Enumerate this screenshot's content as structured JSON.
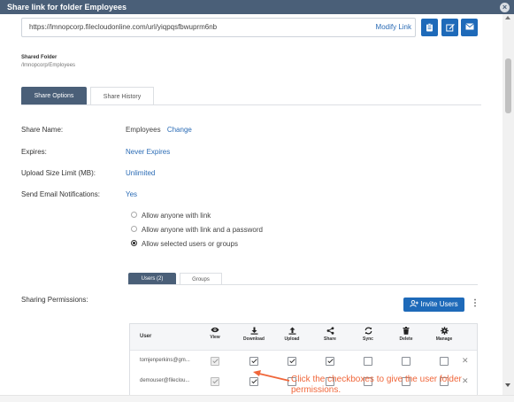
{
  "dialog": {
    "title": "Share link for folder Employees",
    "close_glyph": "×"
  },
  "link": {
    "url": "https://lmnopcorp.filecloudonline.com/url/yiqpqsfbwuprm6nb",
    "modify_label": "Modify Link"
  },
  "actions": [
    {
      "icon": "clipboard-icon"
    },
    {
      "icon": "edit-icon"
    },
    {
      "icon": "mail-icon"
    }
  ],
  "folder": {
    "label": "Shared Folder",
    "path": "/lmnopcorp/Employees"
  },
  "tabs": {
    "options": "Share Options",
    "history": "Share History"
  },
  "fields": {
    "share_name_label": "Share Name:",
    "share_name_value": "Employees",
    "share_name_change": "Change",
    "expires_label": "Expires:",
    "expires_value": "Never Expires",
    "upload_label": "Upload Size Limit (MB):",
    "upload_value": "Unlimited",
    "email_label": "Send Email Notifications:",
    "email_value": "Yes"
  },
  "access": {
    "options": [
      {
        "label": "Allow anyone with link",
        "selected": false
      },
      {
        "label": "Allow anyone with link and a password",
        "selected": false
      },
      {
        "label": "Allow selected users or groups",
        "selected": true
      }
    ]
  },
  "subtabs": {
    "users": "Users (2)",
    "groups": "Groups"
  },
  "sharing_permissions_label": "Sharing Permissions:",
  "invite_label": "Invite Users",
  "kebab_glyph": "⋮",
  "table": {
    "user_header": "User",
    "columns": [
      {
        "label": "View",
        "icon": "eye-icon"
      },
      {
        "label": "Download",
        "icon": "download-icon"
      },
      {
        "label": "Upload",
        "icon": "upload-icon"
      },
      {
        "label": "Share",
        "icon": "share-icon"
      },
      {
        "label": "Sync",
        "icon": "sync-icon"
      },
      {
        "label": "Delete",
        "icon": "trash-icon"
      },
      {
        "label": "Manage",
        "icon": "gear-icon"
      }
    ],
    "rows": [
      {
        "user": "tomjenperkins@gm...",
        "perms": [
          true,
          true,
          true,
          true,
          false,
          false,
          false
        ],
        "remove_glyph": "✕"
      },
      {
        "user": "demouser@fileclou...",
        "perms": [
          true,
          true,
          false,
          false,
          false,
          false,
          false
        ],
        "remove_glyph": "✕"
      }
    ]
  },
  "annotation": {
    "text": "Click the checkboxes to give the user folder permissions.",
    "color": "#f0663a"
  },
  "colors": {
    "accent": "#1e6ab9",
    "header": "#4a5f78",
    "link": "#2a6bb5"
  }
}
